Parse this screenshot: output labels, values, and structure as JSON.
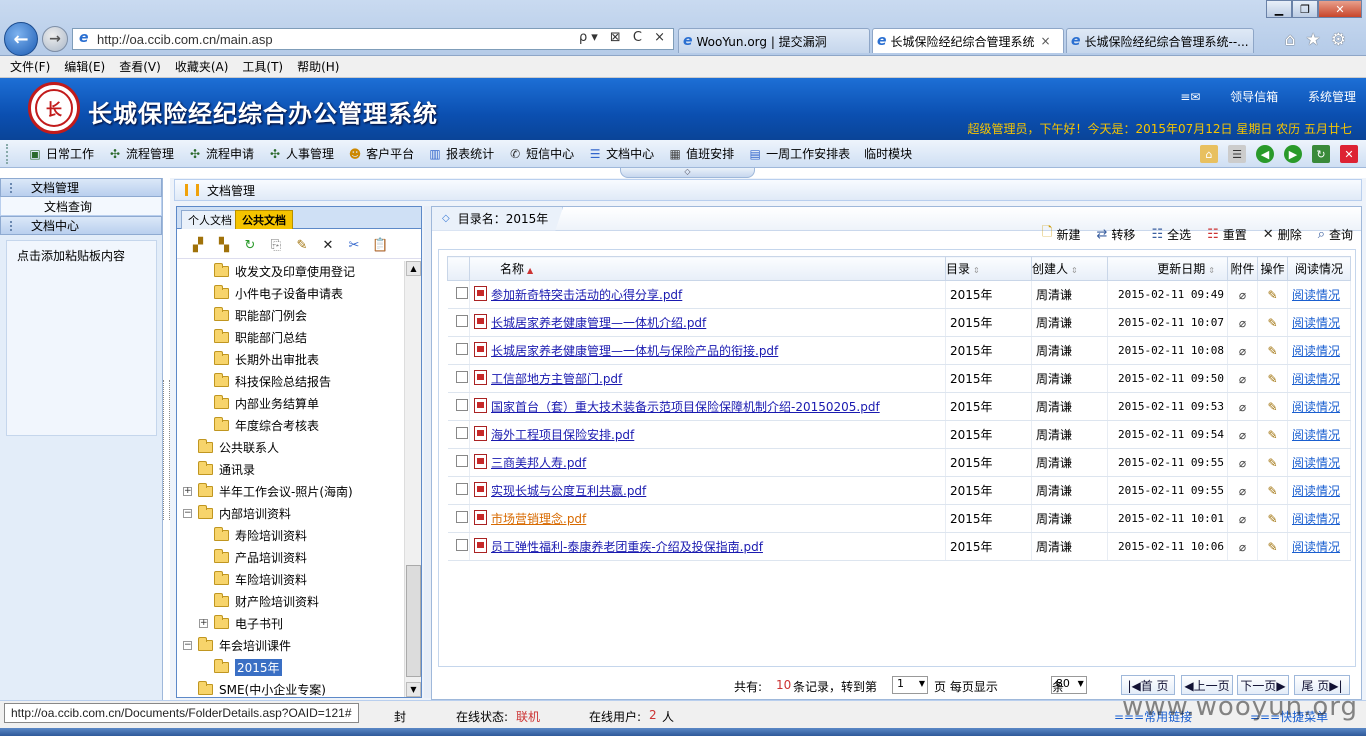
{
  "browser": {
    "url": "http://oa.ccib.com.cn/main.asp",
    "tabs": [
      {
        "label": "WooYun.org | 提交漏洞"
      },
      {
        "label": "长城保险经纪综合管理系统",
        "close": "×"
      },
      {
        "label": "长城保险经纪综合管理系统--..."
      }
    ],
    "addr_tools": "ρ▾ ⊠ C ×"
  },
  "menu": [
    "文件(F)",
    "编辑(E)",
    "查看(V)",
    "收藏夹(A)",
    "工具(T)",
    "帮助(H)"
  ],
  "header": {
    "logo_glyph": "长",
    "title": "长城保险经纪综合办公管理系统",
    "links": [
      "领导信箱",
      "系统管理"
    ],
    "welcome": "超级管理员，下午好！今天是：2015年07月12日 星期日   农历 五月廿七"
  },
  "toolbar": {
    "items": [
      {
        "label": "日常工作",
        "icon": "daily-work-icon"
      },
      {
        "label": "流程管理",
        "icon": "flow-manage-icon"
      },
      {
        "label": "流程申请",
        "icon": "flow-apply-icon"
      },
      {
        "label": "人事管理",
        "icon": "hr-icon"
      },
      {
        "label": "客户平台",
        "icon": "customer-icon"
      },
      {
        "label": "报表统计",
        "icon": "report-icon"
      },
      {
        "label": "短信中心",
        "icon": "sms-icon"
      },
      {
        "label": "文档中心",
        "icon": "document-icon"
      },
      {
        "label": "值班安排",
        "icon": "duty-icon"
      },
      {
        "label": "一周工作安排表",
        "icon": "week-plan-icon"
      },
      {
        "label": "临时模块",
        "icon": ""
      }
    ]
  },
  "left_nav": {
    "section1": "文档管理",
    "section1_sub": "文档查询",
    "section2": "文档中心",
    "clipboard_text": "点击添加粘贴板内容"
  },
  "page_title": "文档管理",
  "tree": {
    "tabs": [
      "个人文档",
      "公共文档"
    ],
    "items": [
      {
        "label": "收发文及印章使用登记",
        "indent": 2
      },
      {
        "label": "小件电子设备申请表",
        "indent": 2
      },
      {
        "label": "职能部门例会",
        "indent": 2
      },
      {
        "label": "职能部门总结",
        "indent": 2
      },
      {
        "label": "长期外出审批表",
        "indent": 2
      },
      {
        "label": "科技保险总结报告",
        "indent": 2
      },
      {
        "label": "内部业务结算单",
        "indent": 2
      },
      {
        "label": "年度综合考核表",
        "indent": 2
      },
      {
        "label": "公共联系人",
        "indent": 1
      },
      {
        "label": "通讯录",
        "indent": 1
      },
      {
        "label": "半年工作会议-照片(海南)",
        "indent": 1,
        "expander": "+"
      },
      {
        "label": "内部培训资料",
        "indent": 1,
        "expander": "−"
      },
      {
        "label": "寿险培训资料",
        "indent": 2
      },
      {
        "label": "产品培训资料",
        "indent": 2
      },
      {
        "label": "车险培训资料",
        "indent": 2
      },
      {
        "label": "财产险培训资料",
        "indent": 2
      },
      {
        "label": "电子书刊",
        "indent": 2,
        "expander": "+"
      },
      {
        "label": "年会培训课件",
        "indent": 1,
        "expander": "−"
      },
      {
        "label": "2015年",
        "indent": 2,
        "selected": true
      },
      {
        "label": "SME(中小企业专案)",
        "indent": 1
      }
    ]
  },
  "doc": {
    "dir_label": "目录名：2015年",
    "actions": [
      {
        "label": "新建",
        "icon": "new-icon"
      },
      {
        "label": "转移",
        "icon": "move-icon"
      },
      {
        "label": "全选",
        "icon": "select-all-icon"
      },
      {
        "label": "重置",
        "icon": "reset-icon"
      },
      {
        "label": "删除",
        "icon": "delete-icon"
      },
      {
        "label": "查询",
        "icon": "search-icon"
      }
    ],
    "columns": [
      "名称",
      "目录",
      "创建人",
      "更新日期",
      "附件",
      "操作",
      "阅读情况"
    ],
    "rows": [
      {
        "name": "参加新奇特突击活动的心得分享.pdf",
        "dir": "2015年",
        "creator": "周清谦",
        "date": "2015-02-11 09:49",
        "read": "阅读情况"
      },
      {
        "name": "长城居家养老健康管理—一体机介绍.pdf",
        "dir": "2015年",
        "creator": "周清谦",
        "date": "2015-02-11 10:07",
        "read": "阅读情况"
      },
      {
        "name": "长城居家养老健康管理—一体机与保险产品的衔接.pdf",
        "dir": "2015年",
        "creator": "周清谦",
        "date": "2015-02-11 10:08",
        "read": "阅读情况"
      },
      {
        "name": "工信部地方主管部门.pdf",
        "dir": "2015年",
        "creator": "周清谦",
        "date": "2015-02-11 09:50",
        "read": "阅读情况"
      },
      {
        "name": "国家首台（套）重大技术装备示范项目保险保障机制介绍-20150205.pdf",
        "dir": "2015年",
        "creator": "周清谦",
        "date": "2015-02-11 09:53",
        "read": "阅读情况"
      },
      {
        "name": "海外工程项目保险安排.pdf",
        "dir": "2015年",
        "creator": "周清谦",
        "date": "2015-02-11 09:54",
        "read": "阅读情况"
      },
      {
        "name": "三商美邦人寿.pdf",
        "dir": "2015年",
        "creator": "周清谦",
        "date": "2015-02-11 09:55",
        "read": "阅读情况"
      },
      {
        "name": "实现长城与公度互利共赢.pdf",
        "dir": "2015年",
        "creator": "周清谦",
        "date": "2015-02-11 09:55",
        "read": "阅读情况"
      },
      {
        "name": "市场营销理念.pdf",
        "dir": "2015年",
        "creator": "周清谦",
        "date": "2015-02-11 10:01",
        "read": "阅读情况",
        "visited": true
      },
      {
        "name": "员工弹性福利-泰康养老团重疾-介绍及投保指南.pdf",
        "dir": "2015年",
        "creator": "周清谦",
        "date": "2015-02-11 10:06",
        "read": "阅读情况"
      }
    ],
    "pager": {
      "total_prefix": "共有:",
      "total": "10",
      "total_suffix": "条记录，转到第",
      "page": "1",
      "page_suffix": "页  每页显示",
      "per_page": "80",
      "per_page_suffix": "条",
      "first": "|◀首 页",
      "prev": "◀上一页",
      "next": "下一页▶",
      "last": "尾 页▶|"
    }
  },
  "status": {
    "url": "http://oa.ccib.com.cn/Documents/FolderDetails.asp?OAID=121#",
    "seal": "封",
    "online_label": "在线状态:",
    "online_value": "联机",
    "users_label": "在线用户:",
    "users_count": "2",
    "users_unit": "人",
    "common_links": "===常用链接",
    "quick_menu": "===快捷菜单"
  },
  "watermark": "www.wooyun.org",
  "colors": {
    "header_blue": "#0b4fb0",
    "welcome_gold": "#f5c400",
    "tab_active": "#f5c400",
    "link": "#1a1ab0",
    "danger": "#c62828"
  }
}
